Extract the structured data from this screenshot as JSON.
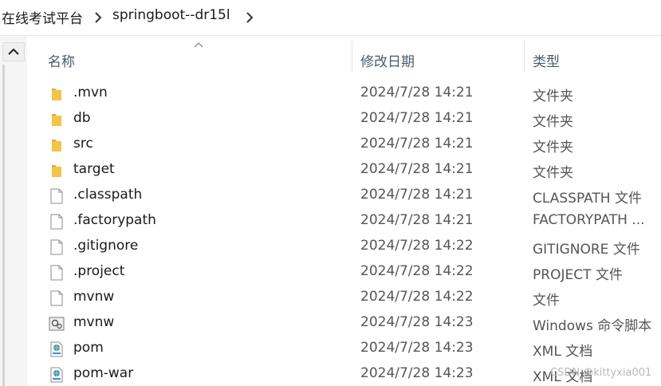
{
  "breadcrumb": {
    "items": [
      "在线考试平台",
      "springboot--dr15l"
    ]
  },
  "columns": {
    "name": "名称",
    "modified": "修改日期",
    "type": "类型"
  },
  "files": [
    {
      "name": ".mvn",
      "modified": "2024/7/28 14:21",
      "type": "文件夹",
      "icon": "folder-icon"
    },
    {
      "name": "db",
      "modified": "2024/7/28 14:21",
      "type": "文件夹",
      "icon": "folder-icon"
    },
    {
      "name": "src",
      "modified": "2024/7/28 14:21",
      "type": "文件夹",
      "icon": "folder-icon"
    },
    {
      "name": "target",
      "modified": "2024/7/28 14:21",
      "type": "文件夹",
      "icon": "folder-icon"
    },
    {
      "name": ".classpath",
      "modified": "2024/7/28 14:21",
      "type": "CLASSPATH 文件",
      "icon": "file-icon"
    },
    {
      "name": ".factorypath",
      "modified": "2024/7/28 14:21",
      "type": "FACTORYPATH ...",
      "icon": "file-icon"
    },
    {
      "name": ".gitignore",
      "modified": "2024/7/28 14:22",
      "type": "GITIGNORE 文件",
      "icon": "file-icon"
    },
    {
      "name": ".project",
      "modified": "2024/7/28 14:22",
      "type": "PROJECT 文件",
      "icon": "file-icon"
    },
    {
      "name": "mvnw",
      "modified": "2024/7/28 14:22",
      "type": "文件",
      "icon": "file-icon"
    },
    {
      "name": "mvnw",
      "modified": "2024/7/28 14:23",
      "type": "Windows 命令脚本",
      "icon": "script-icon"
    },
    {
      "name": "pom",
      "modified": "2024/7/28 14:23",
      "type": "XML 文档",
      "icon": "xml-icon"
    },
    {
      "name": "pom-war",
      "modified": "2024/7/28 14:23",
      "type": "XML 文档",
      "icon": "xml-icon"
    }
  ],
  "watermark": "CSDN @kittyxia001",
  "colors": {
    "folder": "#f3c44a",
    "header_text": "#4b5a6e",
    "secondary_text": "#555555"
  }
}
